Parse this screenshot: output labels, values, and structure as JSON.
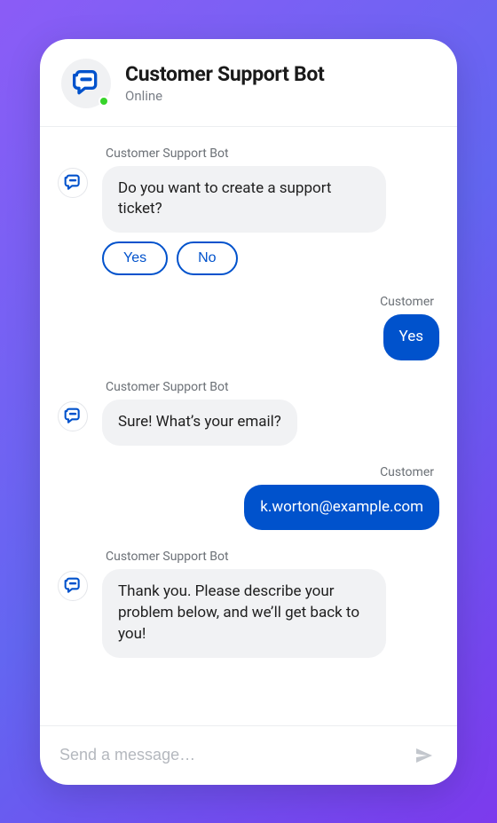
{
  "header": {
    "title": "Customer Support Bot",
    "status": "Online"
  },
  "labels": {
    "bot": "Customer Support Bot",
    "customer": "Customer"
  },
  "messages": [
    {
      "from": "bot",
      "text": "Do you want to create a support ticket?",
      "quick_replies": [
        "Yes",
        "No"
      ]
    },
    {
      "from": "customer",
      "text": "Yes"
    },
    {
      "from": "bot",
      "text": "Sure! What’s your email?"
    },
    {
      "from": "customer",
      "text": "k.worton@example.com"
    },
    {
      "from": "bot",
      "text": "Thank you. Please describe your problem below, and we’ll get back to you!"
    }
  ],
  "composer": {
    "placeholder": "Send a message…"
  }
}
